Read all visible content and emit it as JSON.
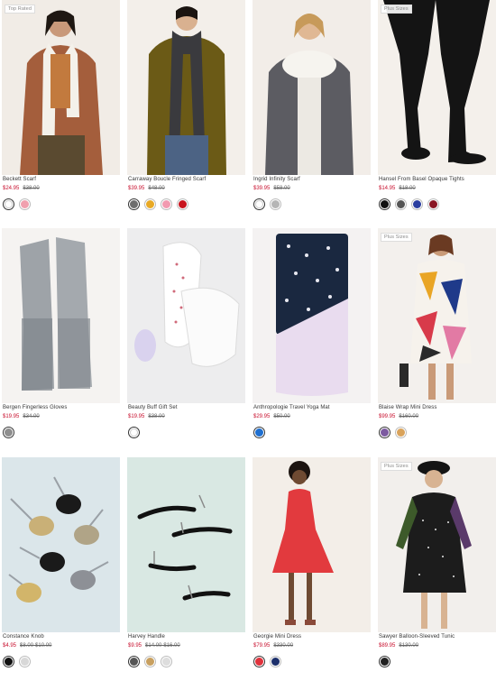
{
  "products": [
    {
      "name": "Beckett Scarf",
      "badge": "Top Rated",
      "sale_price": "$24.95",
      "orig_price": "$38.00",
      "swatches": [
        "#ffffff",
        "#f0a0ae"
      ]
    },
    {
      "name": "Carraway Boucle Fringed Scarf",
      "badge": "",
      "sale_price": "$39.95",
      "orig_price": "$48.00",
      "swatches": [
        "#6e6e6e",
        "#e8a925",
        "#f29ab0",
        "#c8141e"
      ]
    },
    {
      "name": "Ingrid Infinity Scarf",
      "badge": "",
      "sale_price": "$39.95",
      "orig_price": "$58.00",
      "swatches": [
        "#ffffff",
        "#b5b5b5"
      ]
    },
    {
      "name": "Hansel From Basel Opaque Tights",
      "badge": "Plus Sizes",
      "sale_price": "$14.95",
      "orig_price": "$18.00",
      "swatches": [
        "#111111",
        "#555555",
        "#2a3ea0",
        "#8a1624"
      ]
    },
    {
      "name": "Bergen Fingerless Gloves",
      "badge": "",
      "sale_price": "$19.95",
      "orig_price": "$34.00",
      "swatches": [
        "#8e8e8e"
      ]
    },
    {
      "name": "Beauty Buff Gift Set",
      "badge": "",
      "sale_price": "$19.95",
      "orig_price": "$38.00",
      "swatches": [
        "#ffffff"
      ]
    },
    {
      "name": "Anthropologie Travel Yoga Mat",
      "badge": "",
      "sale_price": "$29.95",
      "orig_price": "$50.00",
      "swatches": [
        "#1e6fd0"
      ]
    },
    {
      "name": "Blaise Wrap Mini Dress",
      "badge": "Plus Sizes",
      "sale_price": "$99.95",
      "orig_price": "$160.00",
      "swatches": [
        "#7c5aa0",
        "#d9a35b"
      ]
    },
    {
      "name": "Constance Knob",
      "badge": "",
      "sale_price": "$4.95",
      "orig_price": "$8.00-$10.00",
      "swatches": [
        "#111111",
        "#d8d8d8"
      ]
    },
    {
      "name": "Harvey Handle",
      "badge": "",
      "sale_price": "$9.95",
      "orig_price": "$14.00-$16.00",
      "swatches": [
        "#555555",
        "#c8a060",
        "#dddddd"
      ]
    },
    {
      "name": "Georgie Mini Dress",
      "badge": "",
      "sale_price": "$79.95",
      "orig_price": "$330.00",
      "swatches": [
        "#e0323c",
        "#1c2f6b"
      ]
    },
    {
      "name": "Sawyer Balloon-Sleeved Tunic",
      "badge": "Plus Sizes",
      "sale_price": "$89.95",
      "orig_price": "$130.00",
      "swatches": [
        "#222222"
      ]
    }
  ]
}
